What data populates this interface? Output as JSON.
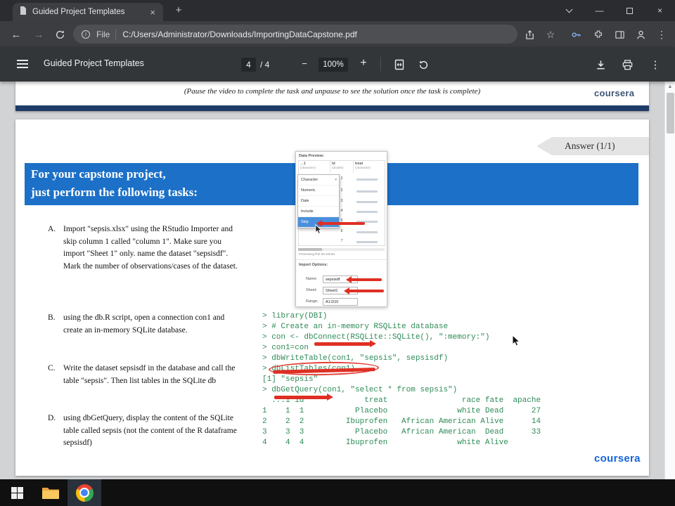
{
  "browser": {
    "tab_title": "Guided Project Templates",
    "address": {
      "scheme_label": "File",
      "url": "C:/Users/Administrator/Downloads/ImportingDataCapstone.pdf"
    }
  },
  "pdf_toolbar": {
    "title": "Guided Project Templates",
    "page_current": "4",
    "page_total_label": "/ 4",
    "zoom_out": "−",
    "zoom_level": "100%",
    "zoom_in": "+"
  },
  "icons": {
    "back": "←",
    "forward": "→",
    "star": "☆",
    "overflow": "⋮",
    "tab_close": "×",
    "window_close": "×",
    "new_tab": "+",
    "minimize": "—",
    "info": "i",
    "scroll_up": "▲",
    "sheet_caret": "▾",
    "col_caret": "▾"
  },
  "colors": {
    "banner_blue": "#1c70c7",
    "console_green": "#2e8b57",
    "annotation_red": "#df2f24",
    "coursera_blue": "#1565d8",
    "footer_navy": "#1e3c67"
  },
  "document": {
    "page3": {
      "note": "(Pause the video to complete the task and unpause to see the solution once the task is complete)",
      "logo": "coursera"
    },
    "page4": {
      "answer": "Answer (1/1)",
      "banner": {
        "line1": "For your capstone project,",
        "line2": "just perform the following tasks:"
      },
      "tasks": [
        {
          "letter": "A.",
          "text": "Import \"sepsis.xlsx\" using the RStudio Importer and skip column 1 called \"column 1\". Make sure you import \"Sheet 1\" only. name the dataset \"sepsisdf\". Mark the number of observations/cases of the dataset."
        },
        {
          "letter": "B.",
          "text": "using the db.R script, open a connection con1 and create an in-memory SQLite database."
        },
        {
          "letter": "C.",
          "text": "Write the dataset sepsisdf in the database and call the table \"sepsis\". Then list tables in the SQLite db"
        },
        {
          "letter": "D.",
          "text": "using dbGetQuery, display the content of the SQLite table called sepsis (not the content of the R dataframe sepsisdf)"
        }
      ],
      "console": {
        "lines": [
          "> library(DBI)",
          "> # Create an in-memory RSQLite database",
          "> con <- dbConnect(RSQLite::SQLite(), \":memory:\")",
          "> con1=con",
          "> dbWriteTable(con1, \"sepsis\", sepsisdf)",
          "> dbListTables(con1)",
          "[1] \"sepsis\"",
          "> dbGetQuery(con1, \"select * from sepsis\")",
          "  ...1 id             treat                race fate  apache",
          "1    1  1           Placebo               white Dead      27",
          "2    2  2         Ibuprofen   African American Alive      14",
          "3    3  3           Placebo   African American  Dead      33",
          "4    4  4         Ibuprofen               white Alive"
        ]
      },
      "logo": "coursera"
    },
    "import_dialog": {
      "preview_label": "Data Preview:",
      "columns": [
        {
          "name": "...1",
          "type": "(character)"
        },
        {
          "name": "Id",
          "type": "(double)"
        },
        {
          "name": "treat",
          "type": "(character)"
        }
      ],
      "dropdown": [
        "Character",
        "Numeric",
        "Date",
        "Include",
        "Skip"
      ],
      "row_ids": [
        "1",
        "2",
        "3",
        "4",
        "5",
        "6",
        "7"
      ],
      "preview_note": "Previewing first 50 entries",
      "options_label": "Import Options:",
      "name_label": "Name:",
      "name_value": "sepsisdf",
      "sheet_label": "Sheet:",
      "sheet_value": "Sheet1",
      "range_label": "Range:",
      "range_value": "A1:D10"
    }
  }
}
